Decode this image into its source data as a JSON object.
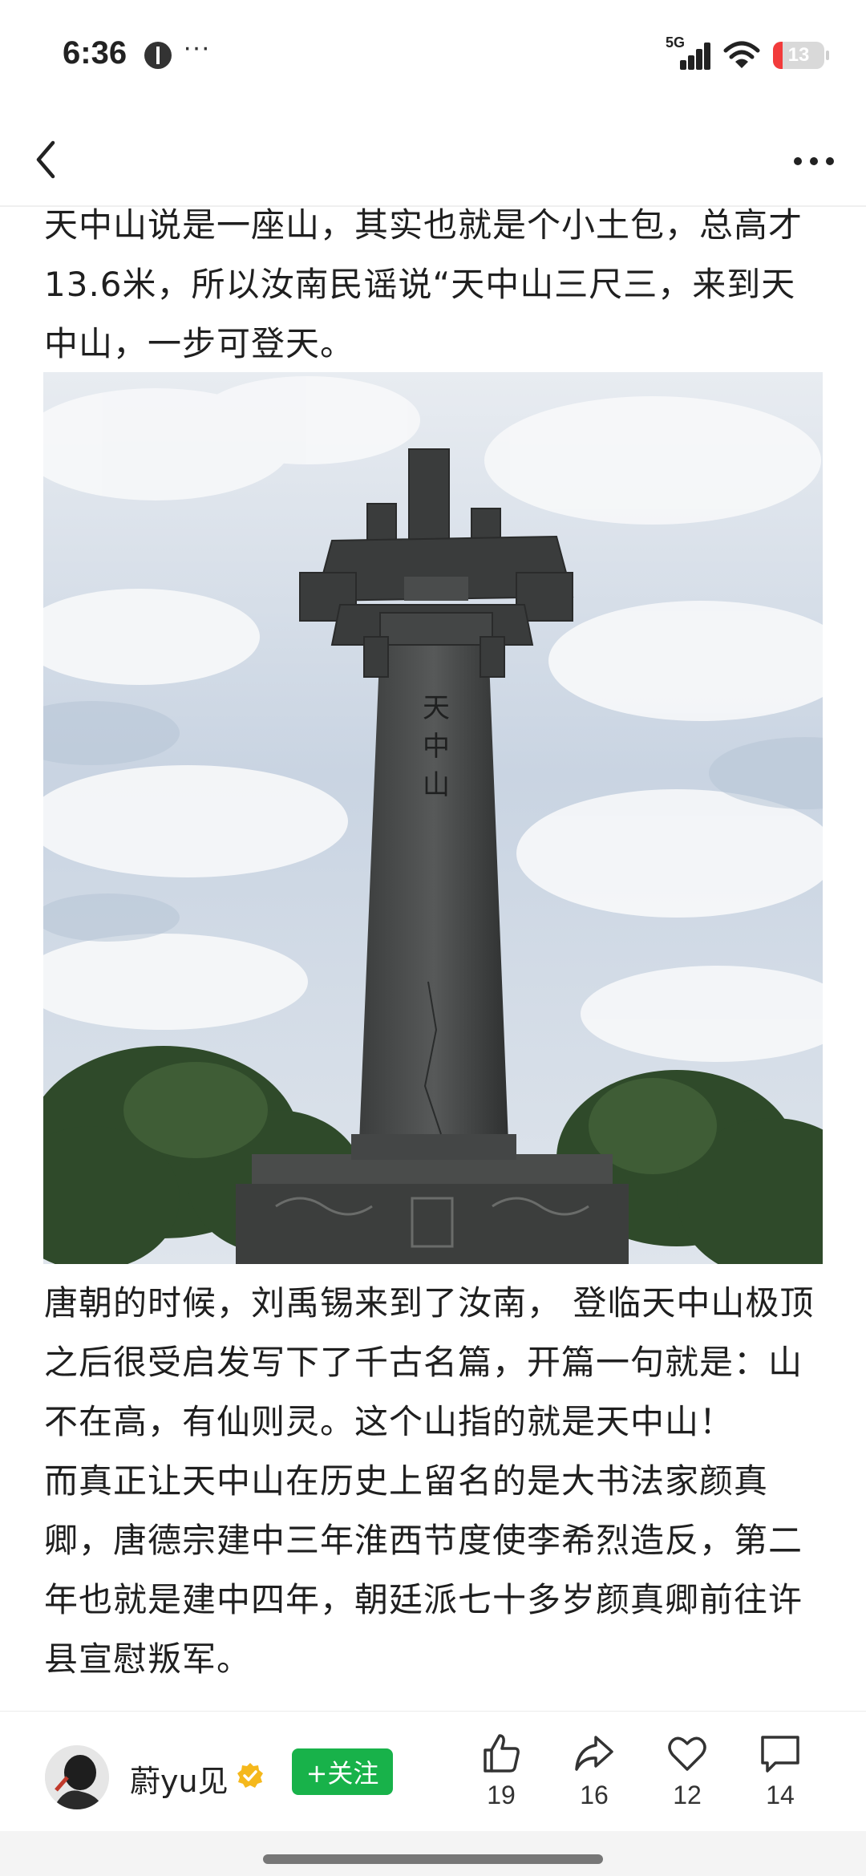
{
  "status_bar": {
    "time": "6:36",
    "more_dots": "···",
    "network": "5G",
    "battery_level": "13",
    "battery_color": "#f23b3b"
  },
  "nav": {
    "back_icon": "chevron-left-icon",
    "more_icon": "more-horizontal-icon"
  },
  "article": {
    "paragraph_1": "天中山说是一座山，其实也就是个小土包，总高才13.6米，所以汝南民谣说“天中山三尺三，来到天中山，一步可登天。",
    "image": {
      "subject": "stone-pillar-monument-photo",
      "inscription": "天中山"
    },
    "paragraph_2": "唐朝的时候，刘禹锡来到了汝南， 登临天中山极顶之后很受启发写下了千古名篇，开篇一句就是：山不在高，有仙则灵。这个山指的就是天中山！",
    "paragraph_3": "而真正让天中山在历史上留名的是大书法家颜真卿，唐德宗建中三年淮西节度使李希烈造反，第二年也就是建中四年，朝廷派七十多岁颜真卿前往许县宣慰叛军。"
  },
  "author": {
    "name": "蔚yu见",
    "follow_label": "+关注",
    "follow_color": "#18b24a"
  },
  "actions": {
    "like_count": "19",
    "share_count": "16",
    "favorite_count": "12",
    "comment_count": "14"
  }
}
